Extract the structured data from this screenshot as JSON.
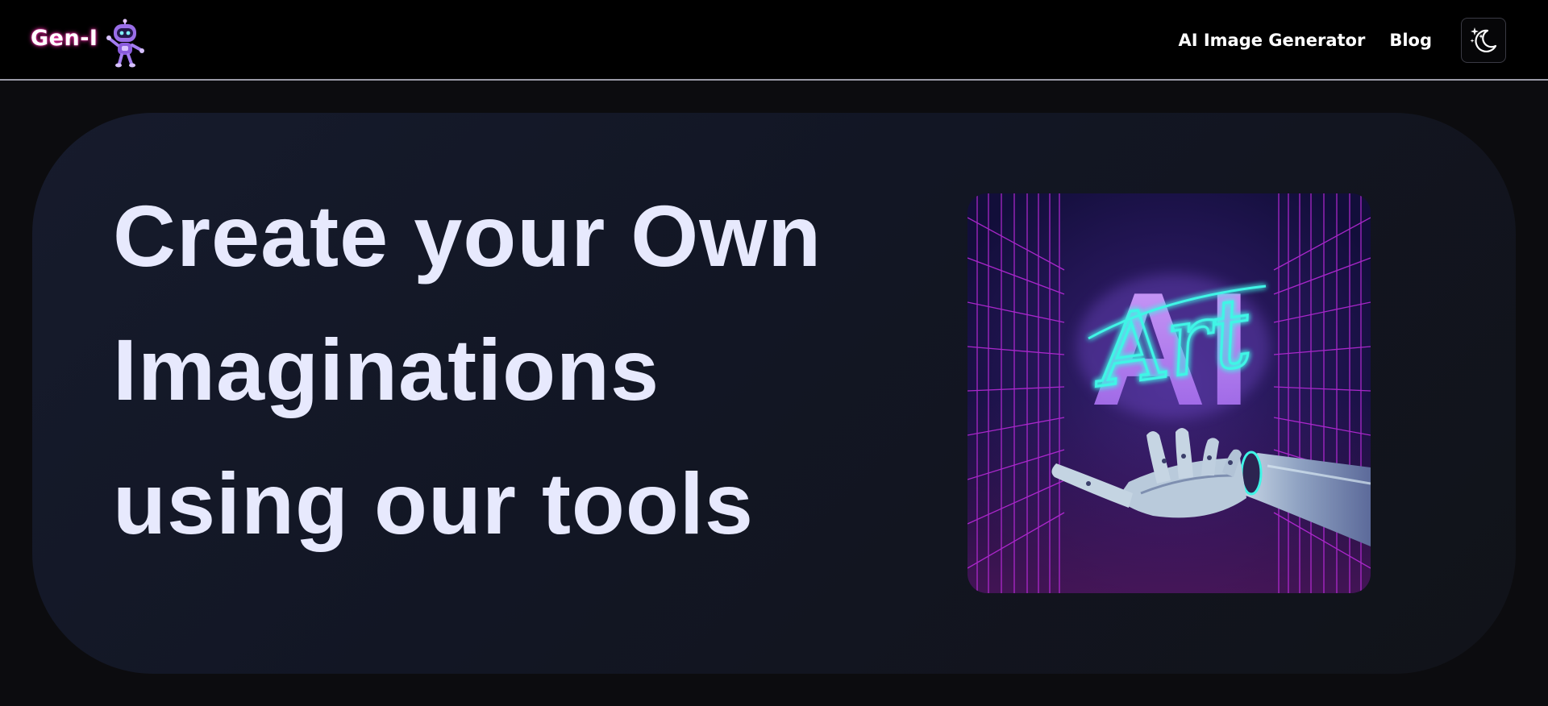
{
  "nav": {
    "brand": "Gen-I",
    "brand_icon": "robot-mascot-icon",
    "links": [
      "AI Image Generator",
      "Blog"
    ],
    "theme_toggle_icon": "moon-stars-icon"
  },
  "hero": {
    "heading_lines": [
      "Create your Own",
      "Imaginations",
      "using our tools"
    ],
    "art": {
      "main_text": "AI",
      "script_text": "Art",
      "image_icon": "robotic-hand-icon"
    }
  },
  "colors": {
    "navbar_bg": "#000000",
    "page_bg": "#0c0c0f",
    "hero_bg": "#141827",
    "heading_text": "#e7e9fd",
    "brand_glow": "#ff2fb0",
    "neon_cyan": "#3ff5e6",
    "neon_purple": "#c58cf5",
    "grid_magenta": "#c02be0"
  }
}
